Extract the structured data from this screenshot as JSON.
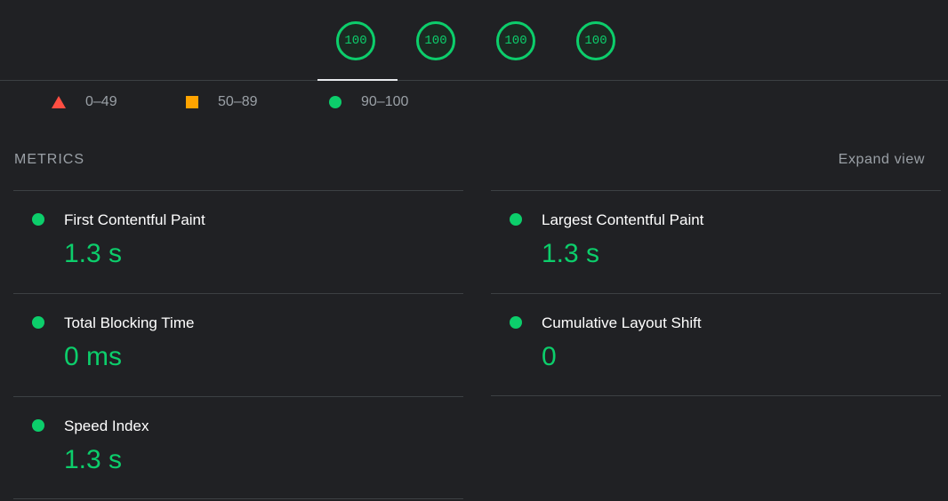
{
  "gauges": [
    {
      "score": "100"
    },
    {
      "score": "100"
    },
    {
      "score": "100"
    },
    {
      "score": "100"
    }
  ],
  "legend": [
    {
      "range": "0–49",
      "shape": "triangle-icon",
      "color": "#ff4e42"
    },
    {
      "range": "50–89",
      "shape": "square-icon",
      "color": "#ffa400"
    },
    {
      "range": "90–100",
      "shape": "circle-icon",
      "color": "#0cce6b"
    }
  ],
  "metrics_section": {
    "title": "METRICS",
    "expand_label": "Expand view"
  },
  "metrics": [
    {
      "label": "First Contentful Paint",
      "value": "1.3 s",
      "status": "pass"
    },
    {
      "label": "Largest Contentful Paint",
      "value": "1.3 s",
      "status": "pass"
    },
    {
      "label": "Total Blocking Time",
      "value": "0 ms",
      "status": "pass"
    },
    {
      "label": "Cumulative Layout Shift",
      "value": "0",
      "status": "pass"
    },
    {
      "label": "Speed Index",
      "value": "1.3 s",
      "status": "pass"
    }
  ],
  "colors": {
    "pass": "#0cce6b",
    "average": "#ffa400",
    "fail": "#ff4e42",
    "background": "#202124"
  }
}
